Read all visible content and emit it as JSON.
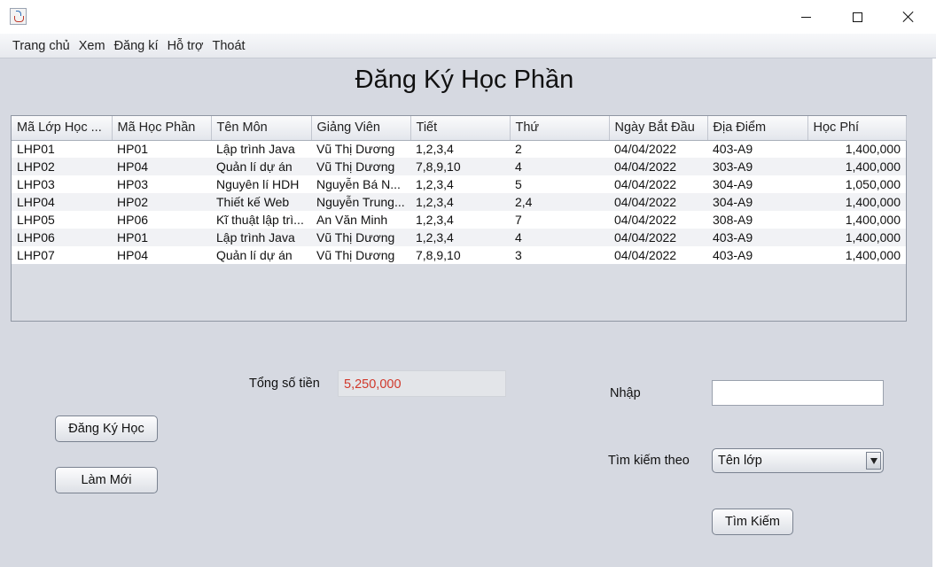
{
  "menu": [
    "Trang chủ",
    "Xem",
    "Đăng kí",
    "Hỗ trợ",
    "Thoát"
  ],
  "page_title": "Đăng Ký Học Phần",
  "table": {
    "columns": [
      "Mã Lớp Học ...",
      "Mã  Học Phần",
      "Tên Môn",
      "Giảng Viên",
      "Tiết",
      "Thứ",
      "Ngày Bắt Đầu",
      "Địa Điểm",
      "Học Phí"
    ],
    "rows": [
      [
        "LHP01",
        "HP01",
        "Lập trình Java",
        "Vũ Thị Dương",
        "1,2,3,4",
        "2",
        "04/04/2022",
        "403-A9",
        "1,400,000"
      ],
      [
        "LHP02",
        "HP04",
        "Quản lí dự án",
        "Vũ Thị Dương",
        "7,8,9,10",
        "4",
        "04/04/2022",
        "303-A9",
        "1,400,000"
      ],
      [
        "LHP03",
        "HP03",
        "Nguyên lí HDH",
        "Nguyễn Bá N...",
        "1,2,3,4",
        "5",
        "04/04/2022",
        "304-A9",
        "1,050,000"
      ],
      [
        "LHP04",
        "HP02",
        "Thiết kế Web",
        "Nguyễn Trung...",
        "1,2,3,4",
        "2,4",
        "04/04/2022",
        "304-A9",
        "1,400,000"
      ],
      [
        "LHP05",
        "HP06",
        "Kĩ thuật lập trì...",
        "An Văn Minh",
        "1,2,3,4",
        "7",
        "04/04/2022",
        "308-A9",
        "1,400,000"
      ],
      [
        "LHP06",
        "HP01",
        "Lập trình Java",
        "Vũ Thị Dương",
        "1,2,3,4",
        "4",
        "04/04/2022",
        "403-A9",
        "1,400,000"
      ],
      [
        "LHP07",
        "HP04",
        "Quản lí dự án",
        "Vũ Thị Dương",
        "7,8,9,10",
        "3",
        "04/04/2022",
        "403-A9",
        "1,400,000"
      ]
    ]
  },
  "total": {
    "label": "Tổng số tiền",
    "value": "5,250,000",
    "value_color": "#d0382b"
  },
  "buttons": {
    "register": "Đăng Ký Học",
    "refresh": "Làm Mới",
    "search": "Tìm Kiếm"
  },
  "search": {
    "input_label": "Nhập",
    "input_value": "",
    "by_label": "Tìm kiếm theo",
    "by_value": "Tên lớp"
  }
}
